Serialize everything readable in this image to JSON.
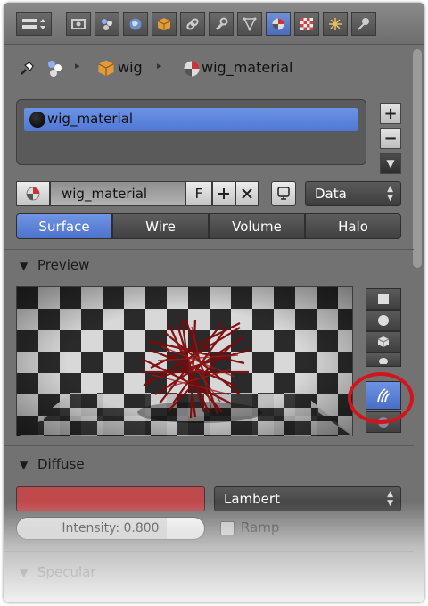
{
  "toolbar": {
    "icons": [
      "editor-type-icon",
      "render-icon",
      "render-layers-icon",
      "world-icon",
      "object-icon",
      "constraints-icon",
      "modifiers-icon",
      "data-icon",
      "material-icon",
      "texture-icon",
      "particles-icon",
      "physics-icon"
    ],
    "active": "material-icon"
  },
  "breadcrumb": {
    "object": "wig",
    "material": "wig_material"
  },
  "material_slots": {
    "items": [
      "wig_material"
    ],
    "add_label": "+",
    "remove_label": "−",
    "menu_label": "▼"
  },
  "datablock": {
    "name": "wig_material",
    "fake_user_label": "F",
    "link_label": "Data"
  },
  "type_tabs": [
    "Surface",
    "Wire",
    "Volume",
    "Halo"
  ],
  "active_type_tab": "Surface",
  "preview_panel": {
    "title": "Preview",
    "buttons": [
      "flat-preview-icon",
      "sphere-preview-icon",
      "cube-preview-icon",
      "monkey-preview-icon",
      "hair-strands-preview-icon",
      "sky-preview-icon"
    ],
    "active": "hair-strands-preview-icon"
  },
  "diffuse_panel": {
    "title": "Diffuse",
    "color": "#bf4a4c",
    "shader": "Lambert",
    "intensity_label": "Intensity: 0.800",
    "intensity": 0.8,
    "ramp_label": "Ramp"
  },
  "specular_panel": {
    "title": "Specular"
  },
  "colors": {
    "accent": "#5a80d8",
    "highlight_circle": "#d4141c",
    "panel": "#727272"
  }
}
